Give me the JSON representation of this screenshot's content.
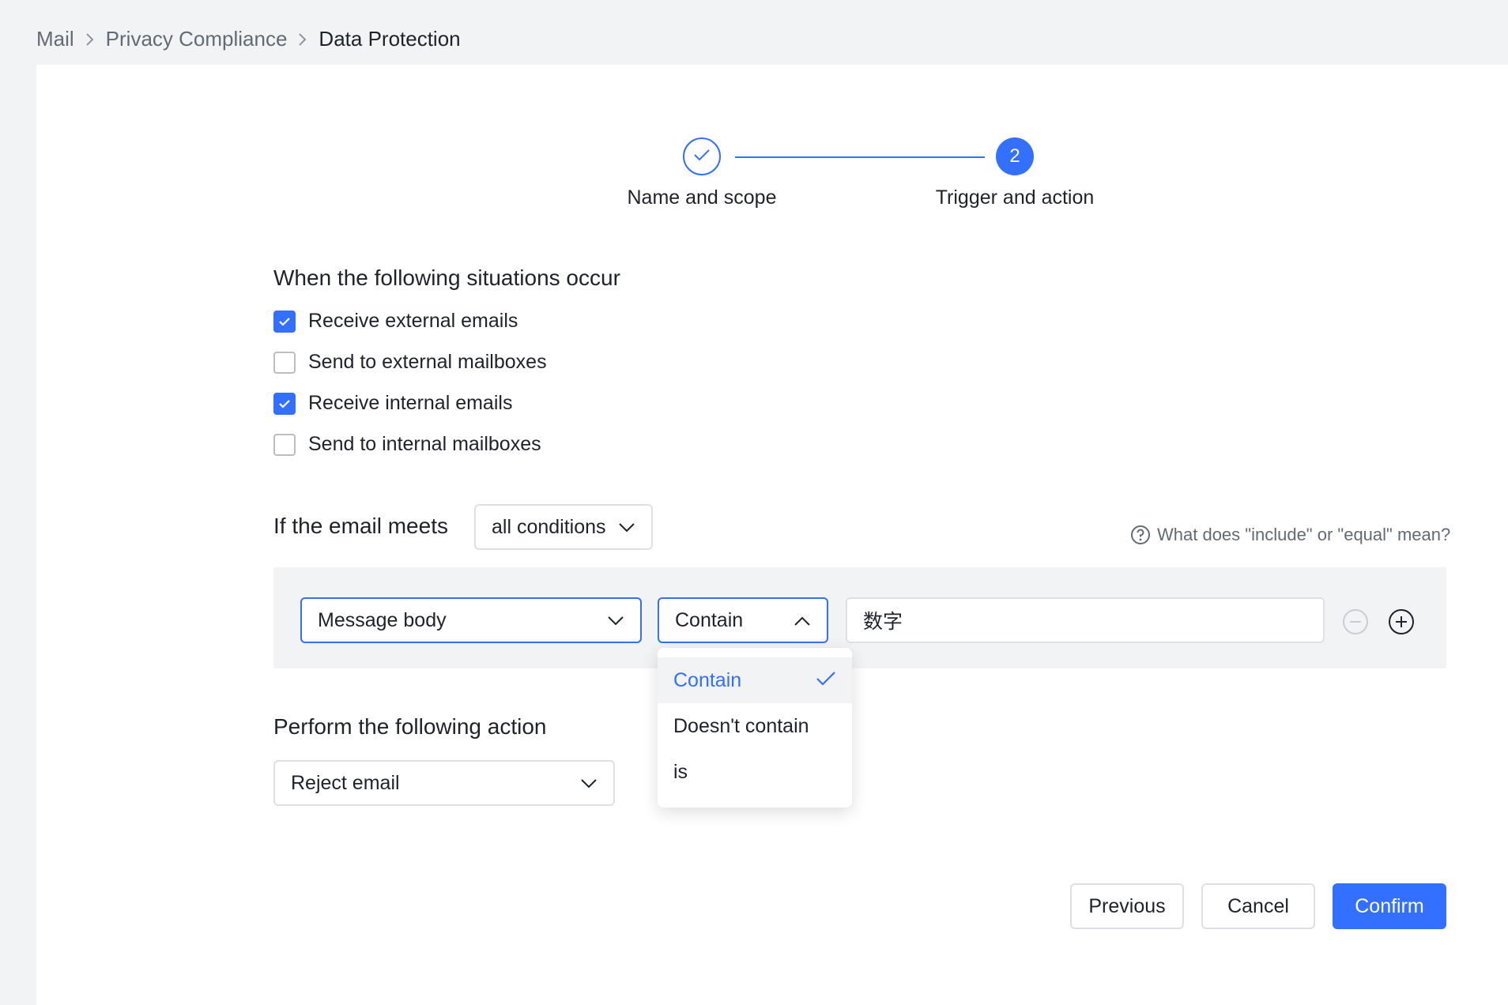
{
  "breadcrumb": {
    "items": [
      "Mail",
      "Privacy Compliance"
    ],
    "current": "Data Protection"
  },
  "stepper": {
    "steps": [
      {
        "label": "Name and scope",
        "state": "done"
      },
      {
        "label": "Trigger and action",
        "number": "2",
        "state": "active"
      }
    ]
  },
  "situations": {
    "title": "When the following situations occur",
    "options": [
      {
        "label": "Receive external emails",
        "checked": true
      },
      {
        "label": "Send to external mailboxes",
        "checked": false
      },
      {
        "label": "Receive internal emails",
        "checked": true
      },
      {
        "label": "Send to internal mailboxes",
        "checked": false
      }
    ]
  },
  "conditions": {
    "prefix": "If the email meets",
    "match_mode": "all conditions",
    "help_text": "What does \"include\" or \"equal\" mean?",
    "rows": [
      {
        "field": "Message body",
        "operator": "Contain",
        "value": "数字"
      }
    ],
    "operator_menu": {
      "options": [
        "Contain",
        "Doesn't contain",
        "is"
      ],
      "selected": "Contain"
    }
  },
  "action": {
    "title": "Perform the following action",
    "value": "Reject email"
  },
  "footer": {
    "previous": "Previous",
    "cancel": "Cancel",
    "confirm": "Confirm"
  },
  "colors": {
    "accent": "#3370ff",
    "text": "#1f2329",
    "muted": "#646a73",
    "border": "#dee0e3"
  }
}
